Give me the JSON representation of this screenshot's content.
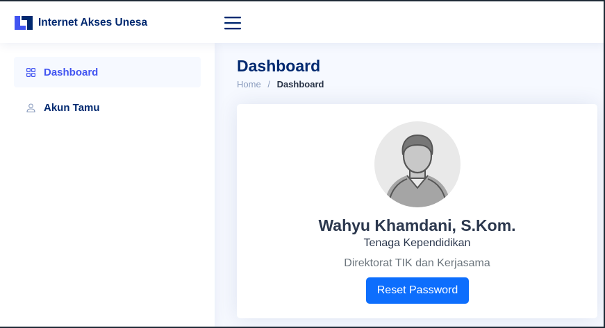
{
  "app": {
    "name": "Internet Akses Unesa",
    "logo_icon": "unesa-logo-icon",
    "menu_icon": "hamburger-menu-icon"
  },
  "sidebar": {
    "items": [
      {
        "label": "Dashboard",
        "icon": "grid-icon",
        "active": true
      },
      {
        "label": "Akun Tamu",
        "icon": "person-icon",
        "active": false
      }
    ]
  },
  "page": {
    "title": "Dashboard",
    "breadcrumb": {
      "home": "Home",
      "separator": "/",
      "current": "Dashboard"
    }
  },
  "profile": {
    "name": "Wahyu Khamdani, S.Kom.",
    "role": "Tenaga Kependidikan",
    "unit": "Direktorat TIK dan Kerjasama",
    "avatar_icon": "default-user-avatar",
    "reset_button": "Reset Password"
  },
  "colors": {
    "primary_text": "#012970",
    "accent": "#4154f1",
    "button": "#0d6efd",
    "background": "#f6f9ff"
  }
}
